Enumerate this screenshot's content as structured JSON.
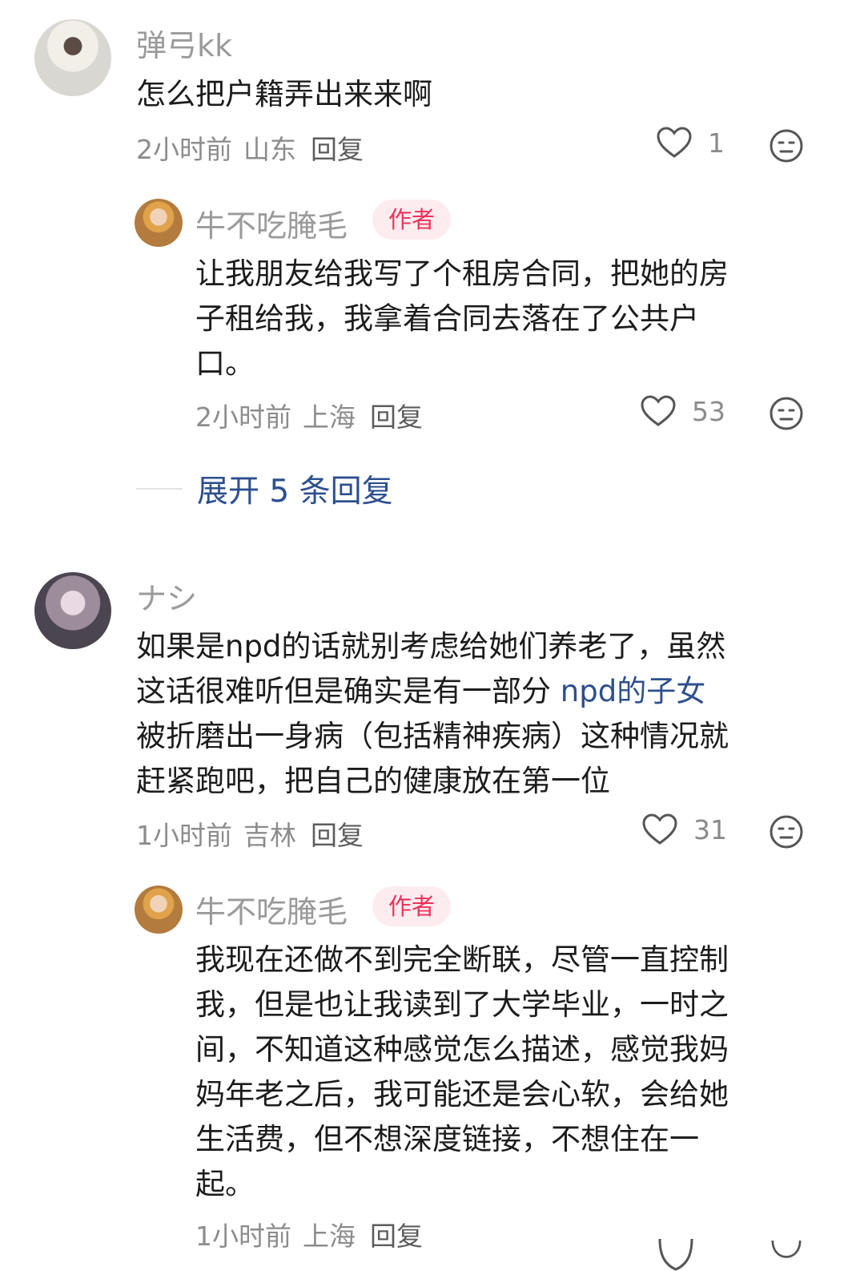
{
  "comments": [
    {
      "user": "弹弓kk",
      "lines": [
        "怎么把户籍弄出来来啊"
      ],
      "time": "2小时前",
      "location": "山东",
      "reply": "回复",
      "likes": "1",
      "replies": [
        {
          "user": "牛不吃腌毛",
          "badge": "作者",
          "lines": [
            "让我朋友给我写了个租房合同，把她的房",
            "子租给我，我拿着合同去落在了公共户",
            "口。"
          ],
          "time": "2小时前",
          "location": "上海",
          "reply": "回复",
          "likes": "53"
        }
      ],
      "expand_label": "展开 5 条回复"
    },
    {
      "user": "ナシ",
      "lines_1": "如果是npd的话就别考虑给她们养老了，虽然",
      "line_2_plain": "这话很难听但是确实是有一部分 ",
      "line_2_link": "npd的子女",
      "lines_rest": [
        "被折磨出一身病（包括精神疾病）这种情况就",
        "赶紧跑吧，把自己的健康放在第一位"
      ],
      "time": "1小时前",
      "location": "吉林",
      "reply": "回复",
      "likes": "31",
      "replies": [
        {
          "user": "牛不吃腌毛",
          "badge": "作者",
          "lines": [
            "我现在还做不到完全断联，尽管一直控制",
            "我，但是也让我读到了大学毕业，一时之",
            "间，不知道这种感觉怎么描述，感觉我妈",
            "妈年老之后，我可能还是会心软，会给她",
            "生活费，但不想深度链接，不想住在一",
            "起。"
          ],
          "time": "1小时前",
          "location": "上海",
          "reply": "回复"
        }
      ]
    }
  ],
  "icons": {
    "like": "heart-outline-icon",
    "dislike": "neutral-face-icon"
  }
}
